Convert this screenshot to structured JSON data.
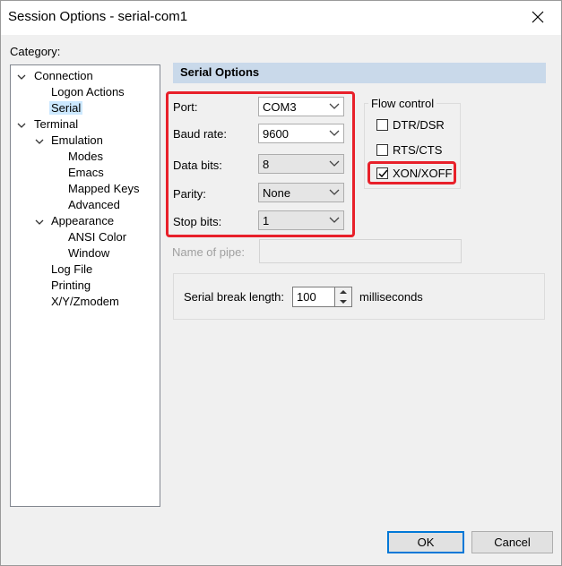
{
  "window": {
    "title": "Session Options - serial-com1"
  },
  "category": {
    "label": "Category:",
    "items": [
      {
        "label": "Connection",
        "expanded": true
      },
      {
        "label": "Logon Actions"
      },
      {
        "label": "Serial",
        "selected": true
      },
      {
        "label": "Terminal",
        "expanded": true
      },
      {
        "label": "Emulation",
        "expanded": true
      },
      {
        "label": "Modes"
      },
      {
        "label": "Emacs"
      },
      {
        "label": "Mapped Keys"
      },
      {
        "label": "Advanced"
      },
      {
        "label": "Appearance",
        "expanded": true
      },
      {
        "label": "ANSI Color"
      },
      {
        "label": "Window"
      },
      {
        "label": "Log File"
      },
      {
        "label": "Printing"
      },
      {
        "label": "X/Y/Zmodem"
      }
    ]
  },
  "serial": {
    "header": "Serial Options",
    "port": {
      "label": "Port:",
      "value": "COM3"
    },
    "baud": {
      "label": "Baud rate:",
      "value": "9600"
    },
    "data_bits": {
      "label": "Data bits:",
      "value": "8"
    },
    "parity": {
      "label": "Parity:",
      "value": "None"
    },
    "stop_bits": {
      "label": "Stop bits:",
      "value": "1"
    },
    "flow_control": {
      "title": "Flow control",
      "dtr_dsr": {
        "label": "DTR/DSR",
        "checked": false
      },
      "rts_cts": {
        "label": "RTS/CTS",
        "checked": false
      },
      "xon_xoff": {
        "label": "XON/XOFF",
        "checked": true
      }
    },
    "pipe": {
      "label": "Name of pipe:",
      "value": ""
    },
    "break": {
      "label": "Serial break length:",
      "value": "100",
      "unit": "milliseconds"
    }
  },
  "buttons": {
    "ok": "OK",
    "cancel": "Cancel"
  },
  "colors": {
    "highlight": "#e8202a",
    "selection": "#cce8ff",
    "header": "#c9d9ea",
    "default_button_border": "#0078d7"
  }
}
